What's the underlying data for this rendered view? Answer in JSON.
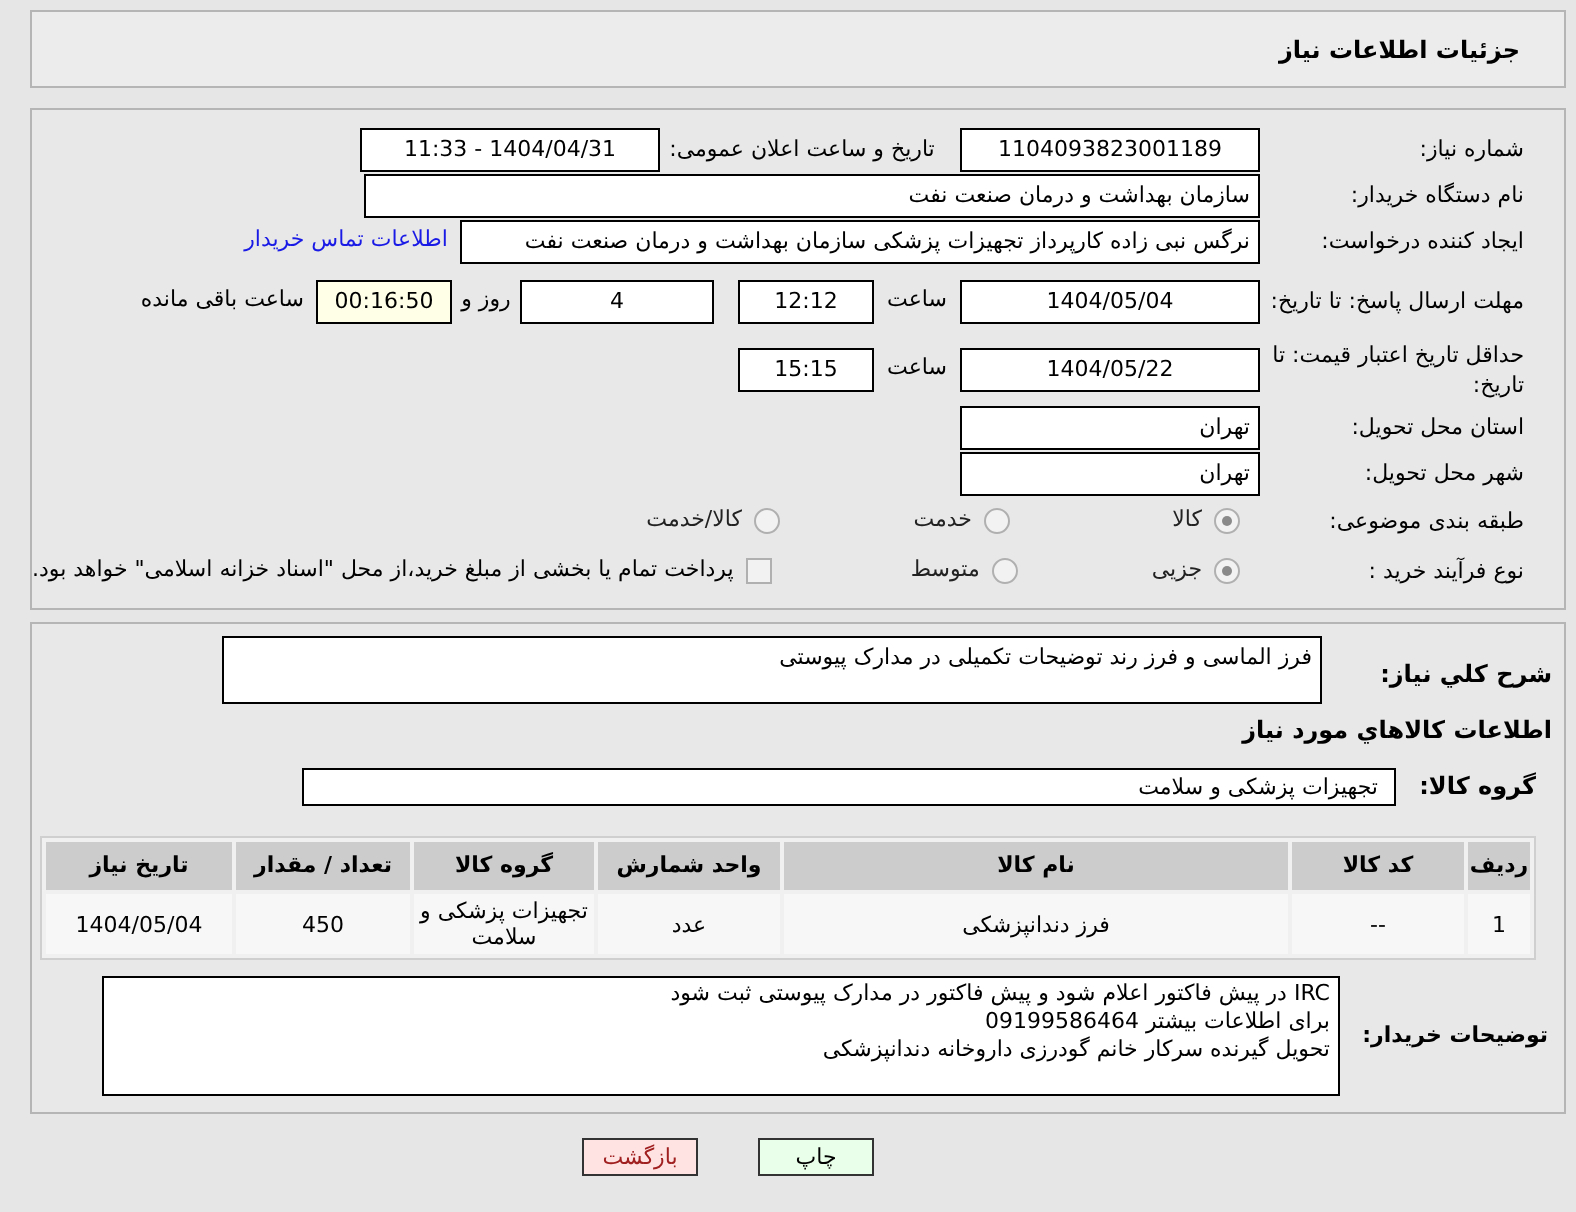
{
  "header": {
    "title": "جزئیات اطلاعات نیاز"
  },
  "need_number": {
    "label": "شماره نیاز:",
    "value": "1104093823001189"
  },
  "announce": {
    "label": "تاریخ و ساعت اعلان عمومی:",
    "value": "1404/04/31 - 11:33"
  },
  "buyer_org": {
    "label": "نام دستگاه خریدار:",
    "value": "سازمان بهداشت و درمان صنعت نفت"
  },
  "requester": {
    "label": "ایجاد کننده درخواست:",
    "value": "نرگس نبی زاده کارپرداز تجهیزات پزشکی سازمان بهداشت و درمان صنعت نفت",
    "link": "اطلاعات تماس خریدار"
  },
  "deadline": {
    "label": "مهلت ارسال پاسخ: تا تاریخ:",
    "date": "1404/05/04",
    "time_label": "ساعت",
    "time": "12:12",
    "days": "4",
    "days_label": "روز و",
    "remaining": "00:16:50",
    "remaining_label": "ساعت باقی مانده"
  },
  "validity": {
    "label": "حداقل تاریخ اعتبار قیمت: تا تاریخ:",
    "date": "1404/05/22",
    "time_label": "ساعت",
    "time": "15:15"
  },
  "province": {
    "label": "استان محل تحویل:",
    "value": "تهران"
  },
  "city": {
    "label": "شهر محل تحویل:",
    "value": "تهران"
  },
  "category": {
    "label": "طبقه بندی موضوعی:",
    "options": [
      {
        "label": "کالا",
        "selected": true
      },
      {
        "label": "خدمت",
        "selected": false
      },
      {
        "label": "کالا/خدمت",
        "selected": false
      }
    ]
  },
  "process": {
    "label": "نوع فرآیند خرید :",
    "options": [
      {
        "label": "جزیی",
        "selected": true
      },
      {
        "label": "متوسط",
        "selected": false
      }
    ],
    "payment": {
      "label": "پرداخت تمام یا بخشی از مبلغ خرید،از محل \"اسناد خزانه اسلامی\" خواهد بود.",
      "checked": false
    }
  },
  "description": {
    "label": "شرح کلي نياز:",
    "value": "فرز الماسی و فرز رند توضیحات تکمیلی در مدارک پیوستی"
  },
  "goods_heading": "اطلاعات کالاهاي مورد نياز",
  "goods_group": {
    "label": "گروه کالا:",
    "value": "تجهیزات پزشکی و سلامت"
  },
  "table": {
    "columns": [
      "ردیف",
      "کد کالا",
      "نام کالا",
      "واحد شمارش",
      "گروه کالا",
      "تعداد / مقدار",
      "تاریخ نیاز"
    ],
    "rows": [
      [
        "1",
        "--",
        "فرز دندانپزشکی",
        "عدد",
        "تجهیزات پزشکی و سلامت",
        "450",
        "1404/05/04"
      ]
    ]
  },
  "buyer_notes": {
    "label": "توضیحات خریدار:",
    "lines": [
      "IRC در پیش فاکتور اعلام شود و پیش فاکتور در مدارک پیوستی ثبت شود",
      "برای اطلاعات بیشتر 09199586464",
      "تحویل گیرنده سرکار خانم گودرزی داروخانه دندانپزشکی"
    ]
  },
  "buttons": [
    {
      "label": "چاپ",
      "kind": "print"
    },
    {
      "label": "بازگشت",
      "kind": "back"
    }
  ]
}
